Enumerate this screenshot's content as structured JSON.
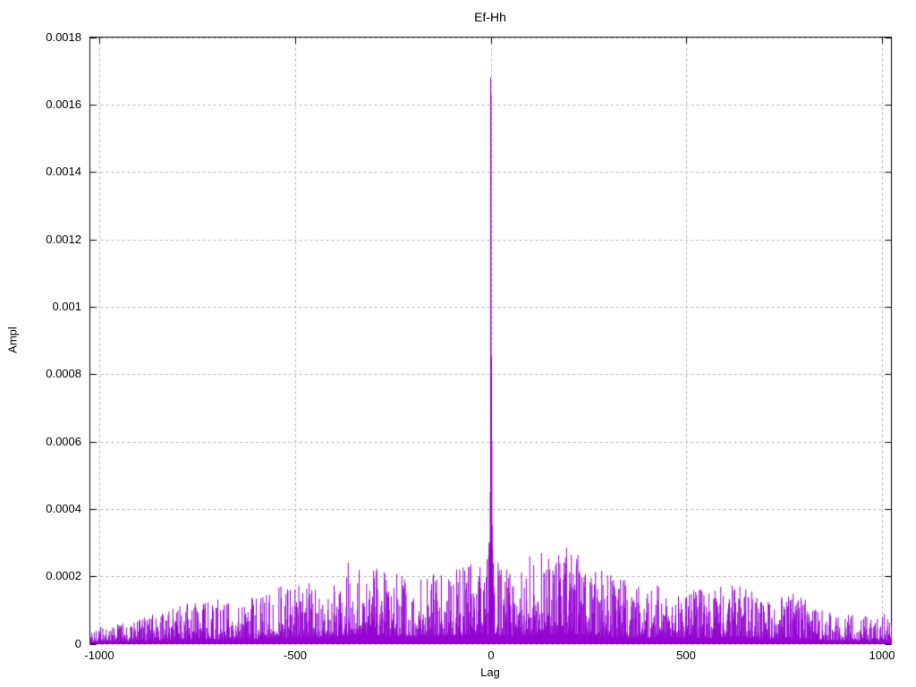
{
  "chart_data": {
    "type": "line",
    "style": "impulses",
    "title": "Ef-Hh",
    "xlabel": "Lag",
    "ylabel": "Ampl",
    "xlim": [
      -1024,
      1024
    ],
    "ylim": [
      0,
      0.0018
    ],
    "grid": true,
    "legend": "none",
    "line_color": "#9400D3",
    "grid_color": "#b0b0b0",
    "border_color": "#000000",
    "x_ticks": [
      {
        "value": -1000,
        "label": "-1000"
      },
      {
        "value": -500,
        "label": "-500"
      },
      {
        "value": 0,
        "label": "0"
      },
      {
        "value": 500,
        "label": "500"
      },
      {
        "value": 1000,
        "label": "1000"
      }
    ],
    "y_ticks": [
      {
        "value": 0.0,
        "label": "0"
      },
      {
        "value": 0.0002,
        "label": "0.0002"
      },
      {
        "value": 0.0004,
        "label": "0.0004"
      },
      {
        "value": 0.0006,
        "label": "0.0006"
      },
      {
        "value": 0.0008,
        "label": "0.0008"
      },
      {
        "value": 0.001,
        "label": "0.001"
      },
      {
        "value": 0.0012,
        "label": "0.0012"
      },
      {
        "value": 0.0014,
        "label": "0.0014"
      },
      {
        "value": 0.0016,
        "label": "0.0016"
      }
    ],
    "top_y_tick": {
      "value": 0.0018,
      "label": "0.0018"
    },
    "peak": {
      "lag": 0,
      "value": 0.00168
    },
    "noise_floor": 4e-06,
    "noise_seed": 1337,
    "envelope_max_by_lag": [
      [
        -1024,
        5e-05
      ],
      [
        -950,
        6e-05
      ],
      [
        -850,
        9e-05
      ],
      [
        -750,
        0.00013
      ],
      [
        -650,
        0.00012
      ],
      [
        -550,
        0.00016
      ],
      [
        -480,
        0.00019
      ],
      [
        -420,
        0.00016
      ],
      [
        -360,
        0.00026
      ],
      [
        -300,
        0.00023
      ],
      [
        -240,
        0.00021
      ],
      [
        -180,
        0.00019
      ],
      [
        -120,
        0.00022
      ],
      [
        -60,
        0.00024
      ],
      [
        -25,
        0.00028
      ],
      [
        0,
        0.00028
      ],
      [
        30,
        0.00022
      ],
      [
        80,
        0.00024
      ],
      [
        130,
        0.00027
      ],
      [
        180,
        0.00028
      ],
      [
        230,
        0.00027
      ],
      [
        280,
        0.00022
      ],
      [
        340,
        0.00019
      ],
      [
        400,
        0.00016
      ],
      [
        460,
        0.00018
      ],
      [
        520,
        0.00017
      ],
      [
        560,
        0.00015
      ],
      [
        620,
        0.0002
      ],
      [
        700,
        0.00013
      ],
      [
        780,
        0.00015
      ],
      [
        850,
        0.0001
      ],
      [
        920,
        8e-05
      ],
      [
        1000,
        9e-05
      ],
      [
        1024,
        7e-05
      ]
    ],
    "central_values_by_lag": [
      [
        -5,
        0.00026
      ],
      [
        -4,
        0.0003
      ],
      [
        -3,
        0.00028
      ],
      [
        -2,
        0.0003
      ],
      [
        -1,
        0.00045
      ],
      [
        0,
        0.00168
      ],
      [
        1,
        0.00163
      ],
      [
        2,
        0.00085
      ],
      [
        3,
        0.0006
      ],
      [
        4,
        0.00035
      ],
      [
        5,
        0.00028
      ]
    ]
  }
}
